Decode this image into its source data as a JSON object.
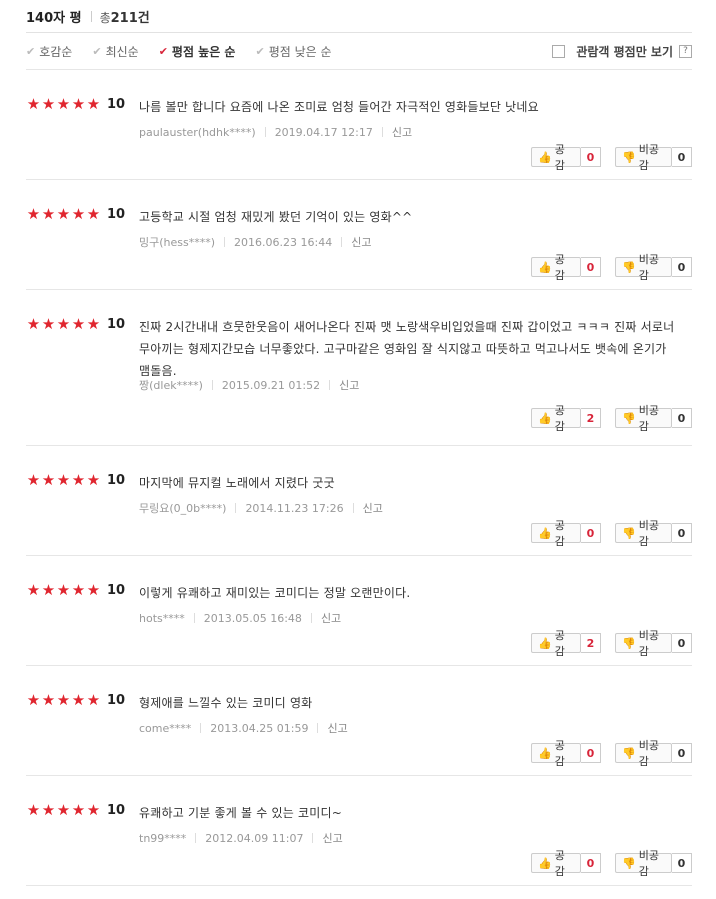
{
  "header": {
    "title": "140자 평",
    "total_prefix": "총",
    "total_count": "211",
    "total_suffix": "건"
  },
  "sort": {
    "items": [
      {
        "label": "호감순",
        "active": false
      },
      {
        "label": "최신순",
        "active": false
      },
      {
        "label": "평점 높은 순",
        "active": true
      },
      {
        "label": "평점 낮은 순",
        "active": false
      }
    ],
    "viewer_only_label": "관람객 평점만 보기",
    "help_label": "?"
  },
  "colors": {
    "star": "#e0262f",
    "accent": "#d8253a"
  },
  "reviews": [
    {
      "stars": "★★★★★",
      "score": "10",
      "text": "나름 볼만 합니다 요즘에 나온 조미료 엄청 들어간 자극적인 영화들보단 낫네요",
      "user": "paulauster(hdhk****)",
      "date": "2019.04.17 12:17",
      "report": "신고",
      "like_label": "공감",
      "like_count": "0",
      "dislike_label": "비공감",
      "dislike_count": "0"
    },
    {
      "stars": "★★★★★",
      "score": "10",
      "text": "고등학교 시절 엄청 재밌게 봤던 기억이 있는 영화^^",
      "user": "밍구(hess****)",
      "date": "2016.06.23 16:44",
      "report": "신고",
      "like_label": "공감",
      "like_count": "0",
      "dislike_label": "비공감",
      "dislike_count": "0"
    },
    {
      "stars": "★★★★★",
      "score": "10",
      "text": "진짜 2시간내내 흐뭇한웃음이 새어나온다 진짜 맷 노랑색우비입었을때 진짜 갑이었고 ㅋㅋㅋ 진짜 서로너무아끼는 형제지간모습 너무좋았다. 고구마같은 영화임 잘 식지않고 따뜻하고 먹고나서도 뱃속에 온기가 맴돌음.",
      "user": "짱(dlek****)",
      "date": "2015.09.21 01:52",
      "report": "신고",
      "like_label": "공감",
      "like_count": "2",
      "dislike_label": "비공감",
      "dislike_count": "0"
    },
    {
      "stars": "★★★★★",
      "score": "10",
      "text": "마지막에 뮤지컬 노래에서 지렸다 굿굿",
      "user": "무링요(0_0b****)",
      "date": "2014.11.23 17:26",
      "report": "신고",
      "like_label": "공감",
      "like_count": "0",
      "dislike_label": "비공감",
      "dislike_count": "0"
    },
    {
      "stars": "★★★★★",
      "score": "10",
      "text": "이렇게 유쾌하고 재미있는 코미디는 정말 오랜만이다.",
      "user": "hots****",
      "date": "2013.05.05 16:48",
      "report": "신고",
      "like_label": "공감",
      "like_count": "2",
      "dislike_label": "비공감",
      "dislike_count": "0"
    },
    {
      "stars": "★★★★★",
      "score": "10",
      "text": "형제애를 느낄수 있는 코미디 영화",
      "user": "come****",
      "date": "2013.04.25 01:59",
      "report": "신고",
      "like_label": "공감",
      "like_count": "0",
      "dislike_label": "비공감",
      "dislike_count": "0"
    },
    {
      "stars": "★★★★★",
      "score": "10",
      "text": "유쾌하고 기분 좋게 볼 수 있는 코미디~",
      "user": "tn99****",
      "date": "2012.04.09 11:07",
      "report": "신고",
      "like_label": "공감",
      "like_count": "0",
      "dislike_label": "비공감",
      "dislike_count": "0"
    }
  ]
}
